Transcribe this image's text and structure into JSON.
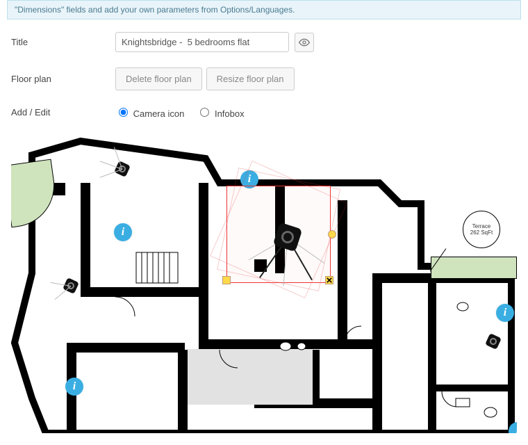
{
  "banner": {
    "text": "\"Dimensions\" fields and add your own parameters from Options/Languages."
  },
  "form": {
    "title_label": "Title",
    "title_value": "Knightsbridge -  5 bedrooms flat",
    "preview_icon_tip": "Preview",
    "floorplan_label": "Floor plan",
    "delete_btn": "Delete floor plan",
    "resize_btn": "Resize floor plan",
    "addedit_label": "Add / Edit",
    "radio_camera": "Camera icon",
    "radio_infobox": "Infobox",
    "radio_selected": "camera"
  },
  "floorplan": {
    "terrace_label_line1": "Terrace",
    "terrace_label_line2": "262 SqFt",
    "info_glyph": "i"
  }
}
